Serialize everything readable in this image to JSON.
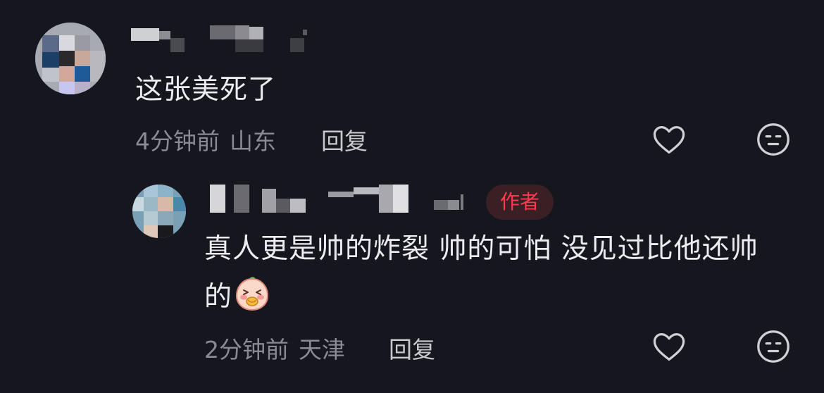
{
  "comments": [
    {
      "text": "这张美死了",
      "time": "4分钟前",
      "location": "山东",
      "reply_label": "回复"
    }
  ],
  "reply": {
    "author_badge": "作者",
    "text": "真人更是帅的炸裂 帅的可怕 没见过比他还帅",
    "text_line2": "的",
    "emoji": "peach-face-emoji",
    "time": "2分钟前",
    "location": "天津",
    "reply_label": "回复"
  },
  "icons": {
    "like": "heart-icon",
    "dislike": "neutral-face-icon"
  },
  "colors": {
    "background": "#16161e",
    "text": "#ececf0",
    "meta": "#8a8a93",
    "badge_bg": "#3a1f24",
    "badge_text": "#ff3a4f"
  }
}
